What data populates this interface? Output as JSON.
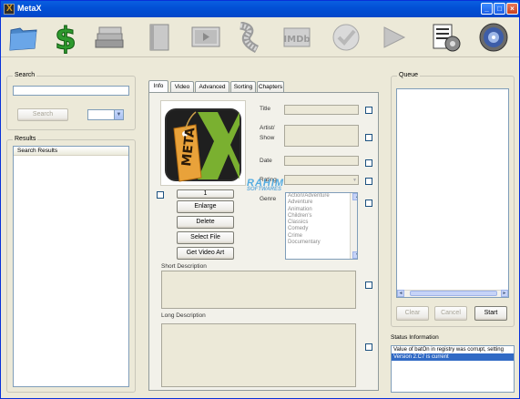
{
  "window": {
    "title": "MetaX"
  },
  "toolbar": {
    "icons": [
      "folder-icon",
      "dollar-icon",
      "books-icon",
      "book-icon",
      "video-icon",
      "film-strip-icon",
      "imdb-icon",
      "checkmark-icon",
      "arrow-right-icon",
      "barcode-settings-icon",
      "globe-icon"
    ]
  },
  "search": {
    "group_label": "Search",
    "input_value": "",
    "button_label": "Search",
    "dropdown_value": ""
  },
  "results": {
    "group_label": "Results",
    "column_header": "Search Results"
  },
  "tabs": [
    "Info",
    "Video",
    "Advanced",
    "Sorting",
    "Chapters"
  ],
  "info": {
    "artwork_text": "META",
    "labels": {
      "title": "Title",
      "artist_show": "Artist/\nShow",
      "date": "Date",
      "rating": "Rating",
      "genre": "Genre"
    },
    "fields": {
      "title": "",
      "artist_show": "",
      "date": "",
      "rating": ""
    },
    "image_index": "1",
    "buttons": {
      "enlarge": "Enlarge",
      "delete": "Delete",
      "select_file": "Select File",
      "get_video_art": "Get Video Art"
    },
    "genres": [
      "Action/Adventure",
      "Adventure",
      "Animation",
      "Children's",
      "Classics",
      "Comedy",
      "Crime",
      "Documentary"
    ],
    "short_description_label": "Short Description",
    "long_description_label": "Long Description"
  },
  "queue": {
    "group_label": "Queue",
    "buttons": {
      "clear": "Clear",
      "cancel": "Cancel",
      "start": "Start"
    }
  },
  "status": {
    "label": "Status Information",
    "lines": [
      {
        "text": "Value of batOn in registry was corrupt, setting",
        "selected": false
      },
      {
        "text": "Version 2.C7 is current",
        "selected": true
      }
    ]
  },
  "watermark": {
    "line1": "RAHIM",
    "line2": "SOFTWARES"
  },
  "colors": {
    "titlebar": "#0250d6",
    "selection": "#316ac5",
    "face": "#ece9d8"
  }
}
